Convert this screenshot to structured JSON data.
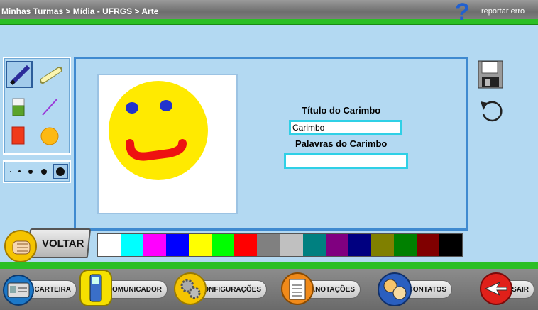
{
  "header": {
    "breadcrumb": "Minhas Turmas > Mídia - UFRGS > Arte",
    "report_label": "reportar erro",
    "help_symbol": "?"
  },
  "toolbox": {
    "tools": [
      "pencil-icon",
      "chalk-icon",
      "eraser-icon",
      "line-icon",
      "rectangle-icon",
      "circle-icon"
    ],
    "selected_tool": "pencil-icon",
    "brush_sizes": [
      "tiny",
      "small",
      "medium",
      "large",
      "xlarge"
    ],
    "selected_size": "xlarge"
  },
  "stamp_form": {
    "title_label": "Título do Carimbo",
    "title_value": "Carimbo",
    "words_label": "Palavras do Carimbo",
    "words_value": ""
  },
  "palette": [
    "#ffffff",
    "#00ffff",
    "#ff00ff",
    "#0000ff",
    "#ffff00",
    "#00ff00",
    "#ff0000",
    "#808080",
    "#c0c0c0",
    "#008080",
    "#800080",
    "#000080",
    "#808000",
    "#008000",
    "#800000",
    "#000000"
  ],
  "actions": {
    "back_label": "VOLTAR"
  },
  "bottom_nav": [
    {
      "label": "CARTEIRA",
      "icon": "wallet-icon"
    },
    {
      "label": "COMUNICADOR",
      "icon": "phone-icon"
    },
    {
      "label": "CONFIGURAÇÕES",
      "icon": "gears-icon"
    },
    {
      "label": "ANOTAÇÕES",
      "icon": "notepad-icon"
    },
    {
      "label": "CONTATOS",
      "icon": "contacts-icon"
    },
    {
      "label": "SAIR",
      "icon": "exit-icon"
    }
  ],
  "colors": {
    "accent_green": "#2bbf25",
    "frame_blue": "#3f8ad0",
    "background": "#b3d9f2"
  }
}
